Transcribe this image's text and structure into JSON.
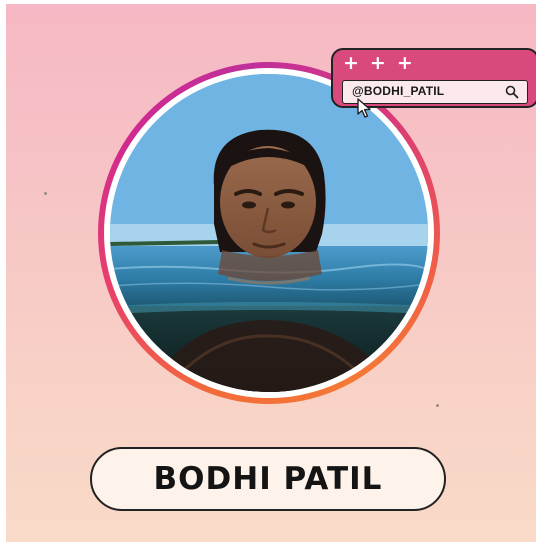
{
  "profile": {
    "handle": "@BODHI_PATIL",
    "name": "BODHI PATIL"
  },
  "search_widget": {
    "plus_signs": [
      "+",
      "+",
      "+"
    ],
    "icon": "search-icon",
    "cursor_icon": "cursor-icon"
  },
  "colors": {
    "background_top": "#f6b8c4",
    "background_bottom": "#f9dac8",
    "widget_pink": "#d9497d",
    "search_field": "#fbe9ec",
    "pill_background": "#fdf3ea",
    "ring_orange": "#f26b3a",
    "ring_magenta": "#d02a8e",
    "outline": "#222222"
  },
  "photo": {
    "subject": "man-in-water-portrait"
  }
}
